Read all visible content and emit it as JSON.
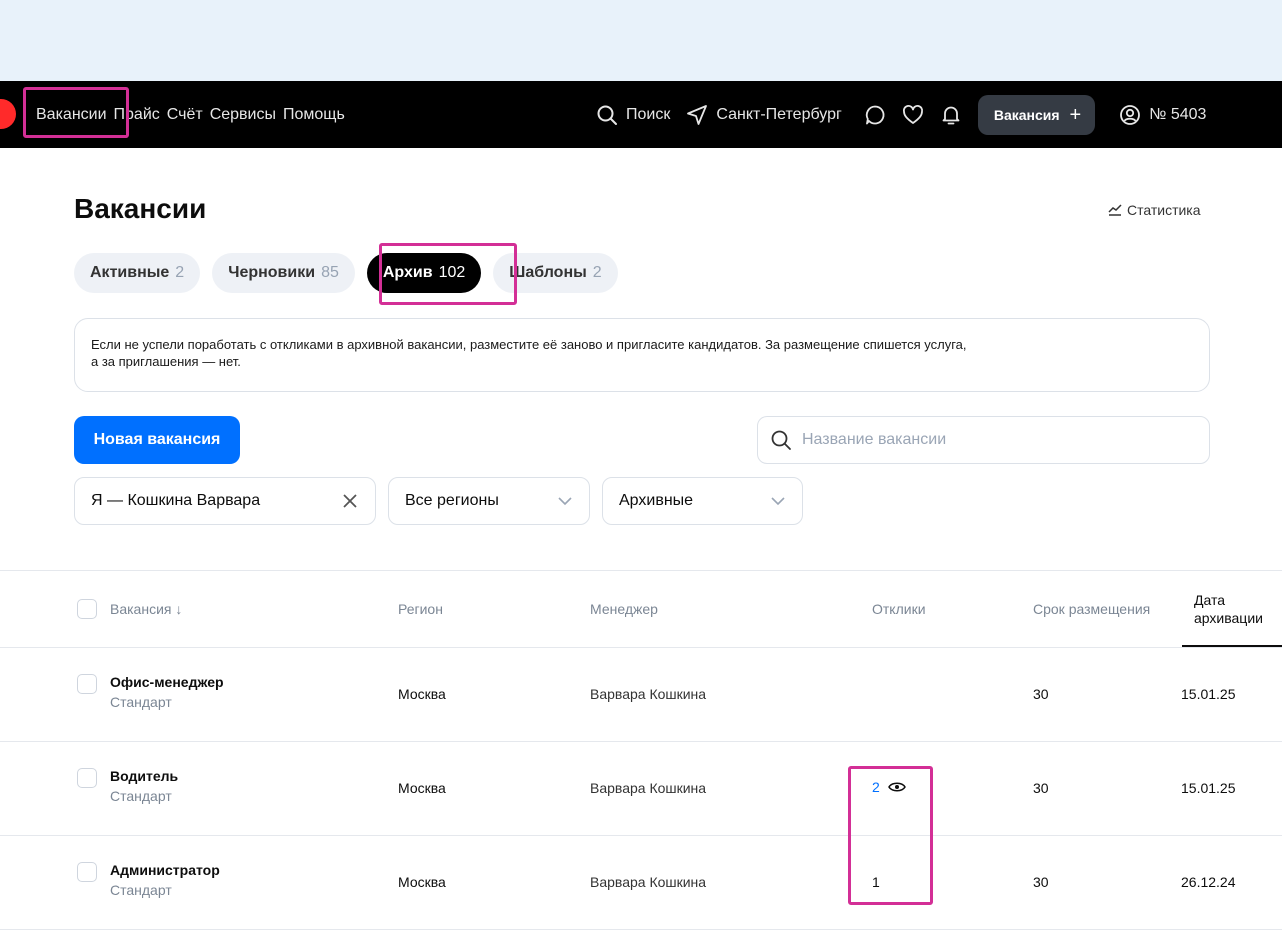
{
  "nav": {
    "links": [
      "Вакансии",
      "Прайс",
      "Счёт",
      "Сервисы",
      "Помощь"
    ],
    "search_label": "Поиск",
    "city": "Санкт-Петербург",
    "post_button": "Вакансия",
    "post_plus": "+",
    "account": "№ 5403"
  },
  "page": {
    "title": "Вакансии",
    "stats_link": "Статистика"
  },
  "tabs": [
    {
      "label": "Активные",
      "count": "2"
    },
    {
      "label": "Черновики",
      "count": "85"
    },
    {
      "label": "Архив",
      "count": "102"
    },
    {
      "label": "Шаблоны",
      "count": "2"
    }
  ],
  "notice": {
    "line1": "Если не успели поработать с откликами в архивной вакансии, разместите её заново и пригласите кандидатов. За размещение спишется услуга,",
    "line2": "а за приглашения — нет."
  },
  "actions": {
    "new_vacancy": "Новая вакансия",
    "search_placeholder": "Название вакансии"
  },
  "filters": {
    "manager": "Я — Кошкина Варвара",
    "region": "Все регионы",
    "status": "Архивные"
  },
  "table": {
    "headers": {
      "vacancy": "Вакансия ↓",
      "region": "Регион",
      "manager": "Менеджер",
      "responses": "Отклики",
      "duration": "Срок размещения",
      "archived_date_1": "Дата",
      "archived_date_2": "архивации"
    },
    "rows": [
      {
        "title": "Офис-менеджер",
        "tariff": "Стандарт",
        "region": "Москва",
        "manager": "Варвара Кошкина",
        "responses": "",
        "duration": "30",
        "date": "15.01.25"
      },
      {
        "title": "Водитель",
        "tariff": "Стандарт",
        "region": "Москва",
        "manager": "Варвара Кошкина",
        "responses": "2",
        "duration": "30",
        "date": "15.01.25"
      },
      {
        "title": "Администратор",
        "tariff": "Стандарт",
        "region": "Москва",
        "manager": "Варвара Кошкина",
        "responses": "1",
        "duration": "30",
        "date": "26.12.24"
      }
    ]
  },
  "colors": {
    "accent": "#0070ff",
    "highlight": "#d32f96",
    "navbar": "#000000"
  }
}
